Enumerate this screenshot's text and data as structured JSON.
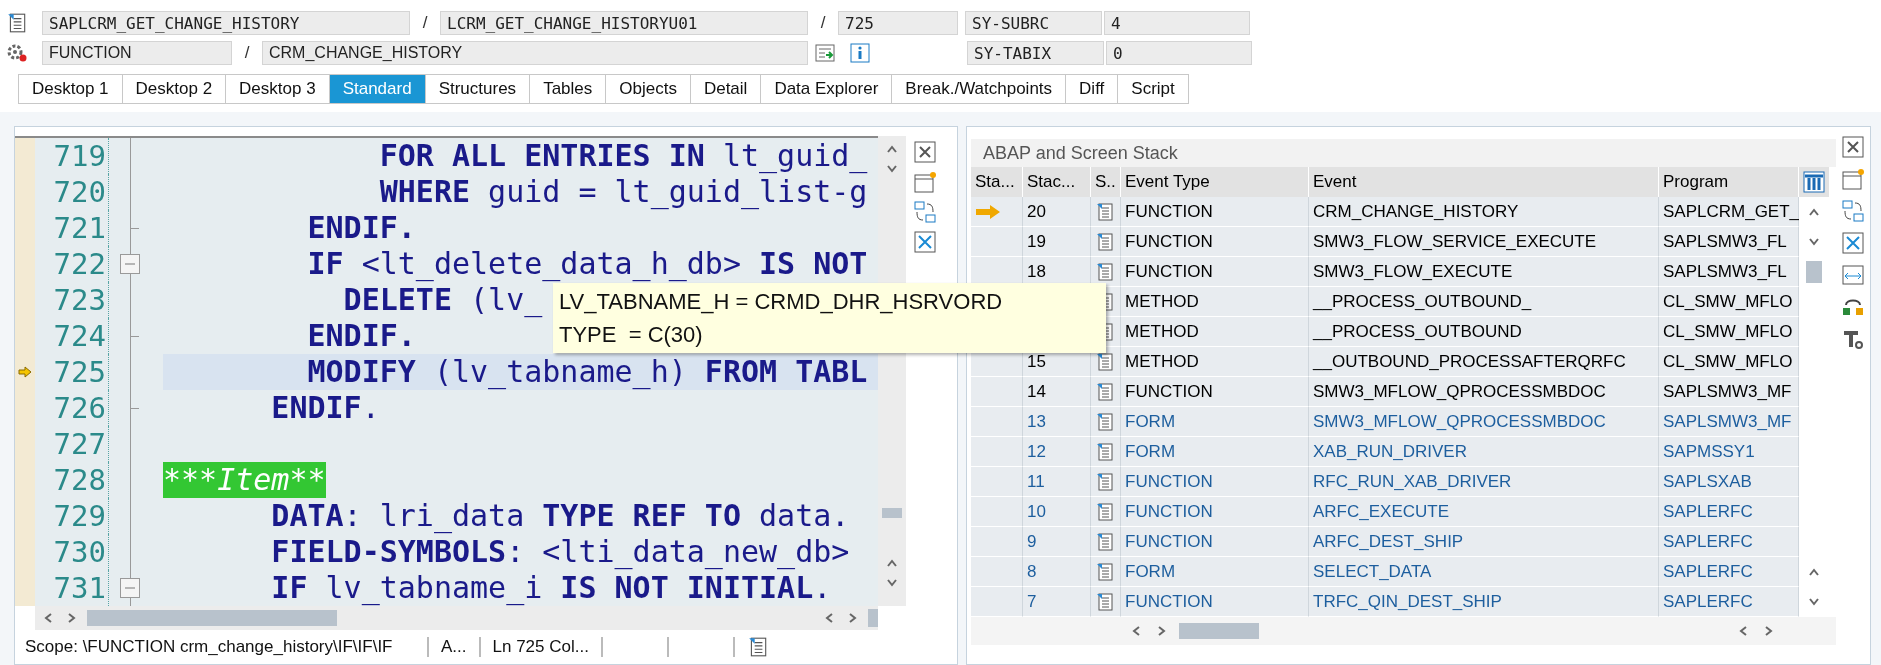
{
  "header": {
    "rows": [
      {
        "items": [
          {
            "kind": "field",
            "value": "SAPLCRM_GET_CHANGE_HISTORY"
          },
          {
            "kind": "separator",
            "text": "/"
          },
          {
            "kind": "field",
            "value": "LCRM_GET_CHANGE_HISTORYU01"
          },
          {
            "kind": "separator",
            "text": "/"
          },
          {
            "kind": "field",
            "value": "725"
          }
        ],
        "sy_label": "SY-SUBRC",
        "sy_value": "4"
      },
      {
        "items": [
          {
            "kind": "field",
            "value": "FUNCTION"
          },
          {
            "kind": "separator",
            "text": "/"
          },
          {
            "kind": "field",
            "value": "CRM_CHANGE_HISTORY"
          },
          {
            "kind": "tools"
          }
        ],
        "sy_label": "SY-TABIX",
        "sy_value": "0"
      }
    ]
  },
  "tabs": [
    {
      "label": "Desktop 1",
      "selected": false
    },
    {
      "label": "Desktop 2",
      "selected": false
    },
    {
      "label": "Desktop 3",
      "selected": false
    },
    {
      "label": "Standard",
      "selected": true
    },
    {
      "label": "Structures",
      "selected": false
    },
    {
      "label": "Tables",
      "selected": false
    },
    {
      "label": "Objects",
      "selected": false
    },
    {
      "label": "Detail",
      "selected": false
    },
    {
      "label": "Data Explorer",
      "selected": false
    },
    {
      "label": "Break./Watchpoints",
      "selected": false
    },
    {
      "label": "Diff",
      "selected": false
    },
    {
      "label": "Script",
      "selected": false
    }
  ],
  "editor": {
    "lines": [
      {
        "number": "719",
        "kind": "code",
        "current": false,
        "collapsible": false,
        "block_end": false,
        "text": "            **FOR ALL ENTRIES IN** lt_guid_"
      },
      {
        "number": "720",
        "kind": "code",
        "current": false,
        "collapsible": false,
        "block_end": false,
        "text": "            **WHERE** guid = lt_guid_list-g"
      },
      {
        "number": "721",
        "kind": "code",
        "current": false,
        "collapsible": false,
        "block_end": true,
        "text": "        **ENDIF.**"
      },
      {
        "number": "722",
        "kind": "code",
        "current": false,
        "collapsible": true,
        "block_end": false,
        "text": "        **IF** <lt_delete_data_h_db> **IS NOT**"
      },
      {
        "number": "723",
        "kind": "code",
        "current": false,
        "collapsible": false,
        "block_end": false,
        "text": "          **DELETE** (lv_"
      },
      {
        "number": "724",
        "kind": "code",
        "current": false,
        "collapsible": false,
        "block_end": true,
        "text": "        **ENDIF.**"
      },
      {
        "number": "725",
        "kind": "code",
        "current": true,
        "collapsible": false,
        "block_end": false,
        "text": "        **MODIFY** (lv_tabname_h) **FROM TABL**"
      },
      {
        "number": "726",
        "kind": "plain",
        "current": false,
        "collapsible": false,
        "block_end": true,
        "text": "      **ENDIF**."
      },
      {
        "number": "727",
        "current": false,
        "collapsible": false,
        "block_end": false
      },
      {
        "number": "728",
        "kind": "comment",
        "current": false,
        "collapsible": false,
        "block_end": false,
        "text": "***Item**"
      },
      {
        "number": "729",
        "kind": "code",
        "current": false,
        "collapsible": false,
        "block_end": false,
        "text": "      **DATA**: lri_data **TYPE REF TO** data."
      },
      {
        "number": "730",
        "kind": "code",
        "current": false,
        "collapsible": false,
        "block_end": false,
        "text": "      **FIELD-SYMBOLS**: <lti_data_new_db>"
      },
      {
        "number": "731",
        "kind": "code",
        "current": false,
        "collapsible": true,
        "block_end": false,
        "text": "      **IF** lv_tabname_i **IS NOT INITIAL**."
      }
    ],
    "status_bar": {
      "scope": "Scope: \\FUNCTION crm_change_history\\IF\\IF\\IF",
      "segments": [
        "A...",
        "Ln 725 Col..."
      ]
    }
  },
  "tooltip": {
    "lines": [
      "LV_TABNAME_H = CRMD_DHR_HSRVORD",
      "TYPE  = C(30)"
    ]
  },
  "stack": {
    "title": "ABAP and Screen Stack",
    "columns": [
      "Sta...",
      "Stac...",
      "S..",
      "Event Type",
      "Event",
      "Program"
    ],
    "rows": [
      {
        "current": true,
        "color": "#000000",
        "level": "20",
        "event_type": "FUNCTION",
        "event": "CRM_CHANGE_HISTORY",
        "program": "SAPLCRM_GET_"
      },
      {
        "current": false,
        "color": "#000000",
        "level": "19",
        "event_type": "FUNCTION",
        "event": "SMW3_FLOW_SERVICE_EXECUTE",
        "program": "SAPLSMW3_FL"
      },
      {
        "current": false,
        "color": "#000000",
        "level": "18",
        "event_type": "FUNCTION",
        "event": "SMW3_FLOW_EXECUTE",
        "program": "SAPLSMW3_FL"
      },
      {
        "current": false,
        "color": "#000000",
        "event_type": "METHOD",
        "event": "__PROCESS_OUTBOUND_",
        "program": "CL_SMW_MFLO"
      },
      {
        "current": false,
        "color": "#000000",
        "event_type": "METHOD",
        "event": "__PROCESS_OUTBOUND",
        "program": "CL_SMW_MFLO"
      },
      {
        "current": false,
        "color": "#000000",
        "level": "15",
        "event_type": "METHOD",
        "event": "__OUTBOUND_PROCESSAFTERQRFC",
        "program": "CL_SMW_MFLO"
      },
      {
        "current": false,
        "color": "#000000",
        "level": "14",
        "event_type": "FUNCTION",
        "event": "SMW3_MFLOW_QPROCESSMBDOC",
        "program": "SAPLSMW3_MF"
      },
      {
        "current": false,
        "color": "#1d5e9e",
        "level": "13",
        "event_type": "FORM",
        "event": "SMW3_MFLOW_QPROCESSMBDOC",
        "program": "SAPLSMW3_MF"
      },
      {
        "current": false,
        "color": "#1d5e9e",
        "level": "12",
        "event_type": "FORM",
        "event": "XAB_RUN_DRIVER",
        "program": "SAPMSSY1"
      },
      {
        "current": false,
        "color": "#1d5e9e",
        "level": "11",
        "event_type": "FUNCTION",
        "event": "RFC_RUN_XAB_DRIVER",
        "program": "SAPLSXAB"
      },
      {
        "current": false,
        "color": "#1d5e9e",
        "level": "10",
        "event_type": "FUNCTION",
        "event": "ARFC_EXECUTE",
        "program": "SAPLERFC"
      },
      {
        "current": false,
        "color": "#1d5e9e",
        "level": "9",
        "event_type": "FUNCTION",
        "event": "ARFC_DEST_SHIP",
        "program": "SAPLERFC"
      },
      {
        "current": false,
        "color": "#1d5e9e",
        "level": "8",
        "event_type": "FORM",
        "event": "SELECT_DATA",
        "program": "SAPLERFC"
      },
      {
        "current": false,
        "color": "#1d5e9e",
        "level": "7",
        "event_type": "FUNCTION",
        "event": "TRFC_QIN_DEST_SHIP",
        "program": "SAPLERFC"
      }
    ]
  }
}
